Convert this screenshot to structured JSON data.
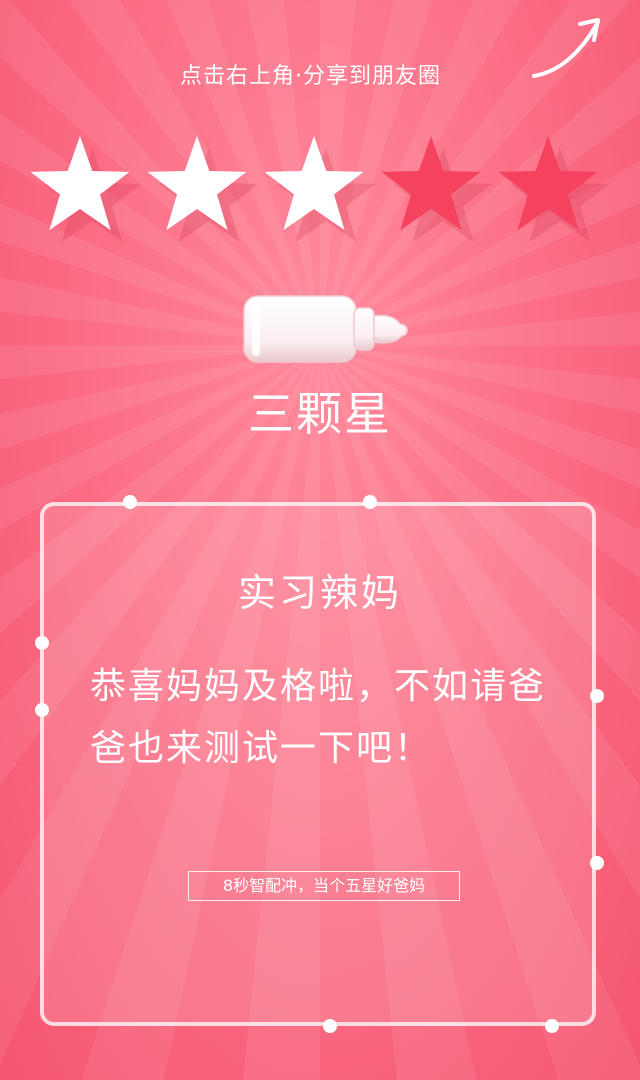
{
  "header": {
    "share_hint": "点击右上角·分享到朋友圈",
    "share_arrow_icon": "arrow-up-right-icon"
  },
  "rating": {
    "stars_filled": 3,
    "stars_total": 5,
    "filled_color": "#ffffff",
    "empty_color": "#f4425f",
    "badge_icon": "baby-bottle-icon",
    "label": "三颗星"
  },
  "result_card": {
    "title": "实习辣妈",
    "message": "恭喜妈妈及格啦，不如请爸爸也来测试一下吧！",
    "slogan": "8秒智配冲，当个五星好爸妈"
  },
  "colors": {
    "background": "#fb6b82",
    "accent": "#ffffff"
  }
}
